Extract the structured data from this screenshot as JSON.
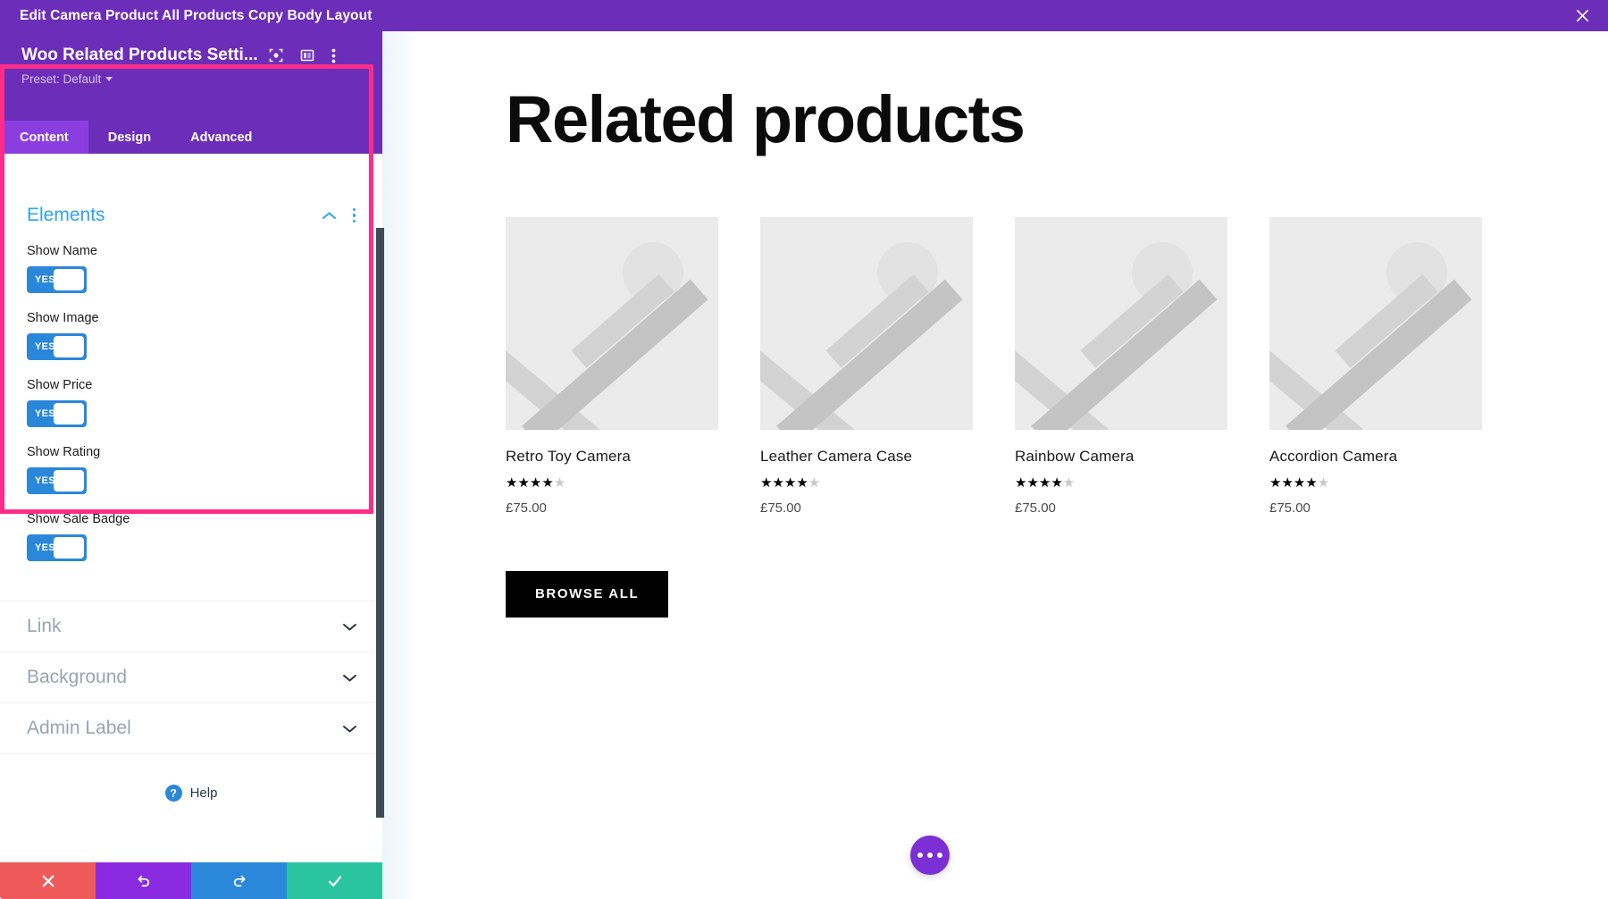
{
  "topbar": {
    "title": "Edit Camera Product All Products Copy Body Layout",
    "close_label": "×"
  },
  "panel": {
    "title": "Woo Related Products Setti...",
    "preset_label": "Preset: Default",
    "header_icons": [
      {
        "name": "focus-target-icon"
      },
      {
        "name": "panel-layout-icon"
      },
      {
        "name": "more-vertical-icon"
      }
    ],
    "tabs": [
      {
        "label": "Content",
        "active": true
      },
      {
        "label": "Design",
        "active": false
      },
      {
        "label": "Advanced",
        "active": false
      }
    ],
    "groups": {
      "elements": {
        "title": "Elements",
        "state": "expanded",
        "fields": [
          {
            "label": "Show Name",
            "value": "YES"
          },
          {
            "label": "Show Image",
            "value": "YES"
          },
          {
            "label": "Show Price",
            "value": "YES"
          },
          {
            "label": "Show Rating",
            "value": "YES"
          },
          {
            "label": "Show Sale Badge",
            "value": "YES"
          }
        ]
      },
      "collapsed": [
        {
          "title": "Link"
        },
        {
          "title": "Background"
        },
        {
          "title": "Admin Label"
        }
      ]
    },
    "help": {
      "badge": "?",
      "label": "Help"
    },
    "actions": [
      {
        "name": "cancel",
        "icon": "close-icon"
      },
      {
        "name": "undo",
        "icon": "undo-icon"
      },
      {
        "name": "redo",
        "icon": "redo-icon"
      },
      {
        "name": "save",
        "icon": "check-icon"
      }
    ]
  },
  "preview": {
    "heading": "Related products",
    "products": [
      {
        "name": "Retro Toy Camera",
        "rating_filled": 4,
        "rating_total": 5,
        "price": "£75.00"
      },
      {
        "name": "Leather Camera Case",
        "rating_filled": 4,
        "rating_total": 5,
        "price": "£75.00"
      },
      {
        "name": "Rainbow Camera",
        "rating_filled": 4,
        "rating_total": 5,
        "price": "£75.00"
      },
      {
        "name": "Accordion Camera",
        "rating_filled": 4,
        "rating_total": 5,
        "price": "£75.00"
      }
    ],
    "browse_button": "BROWSE ALL",
    "fab": {
      "name": "page-settings-fab"
    }
  },
  "colors": {
    "brand_purple": "#6c2eb9",
    "tab_active": "#8a3ee0",
    "highlight_pink": "#ff2d87",
    "toggle_blue": "#2b87da",
    "link_blue": "#2ea3f2",
    "save_green": "#2ac4a1",
    "cancel_red": "#ee5a5a"
  }
}
